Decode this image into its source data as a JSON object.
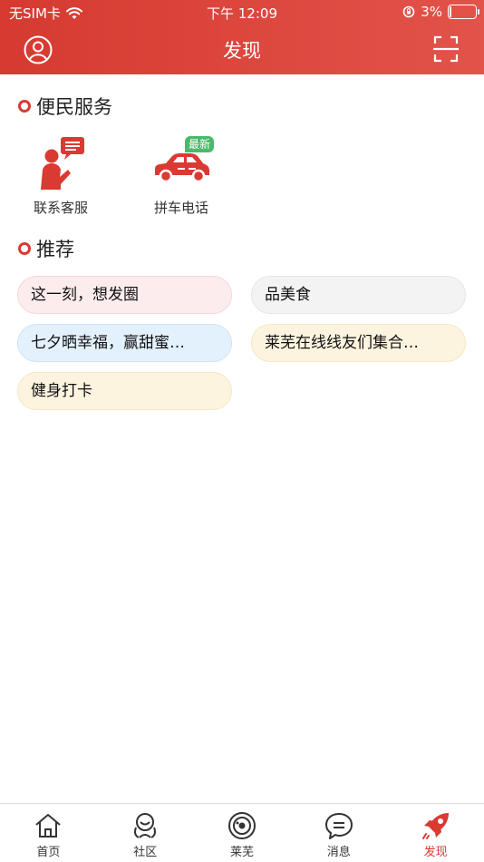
{
  "status_bar": {
    "carrier": "无SIM卡",
    "time": "下午 12:09",
    "battery": "3%",
    "battery_level": 0.03
  },
  "nav": {
    "title": "发现",
    "left_icon": "user-icon",
    "right_icon": "scan-icon"
  },
  "services": {
    "title": "便民服务",
    "items": [
      {
        "label": "联系客服",
        "icon": "customer-service-icon"
      },
      {
        "label": "拼车电话",
        "icon": "car-icon",
        "badge": "最新"
      }
    ]
  },
  "recommend": {
    "title": "推荐",
    "tags": [
      {
        "label": "这一刻，想发圈",
        "bg": "#fdeced",
        "border": "#f8d6d8"
      },
      {
        "label": "品美食",
        "bg": "#f3f3f3",
        "border": "#e6e6e6"
      },
      {
        "label": "七夕晒幸福，赢甜蜜…",
        "bg": "#e3f1fc",
        "border": "#cfe4f6"
      },
      {
        "label": "莱芜在线线友们集合…",
        "bg": "#fdf4df",
        "border": "#f5e8c6"
      },
      {
        "label": "健身打卡",
        "bg": "#fdf4df",
        "border": "#f5e8c6"
      }
    ]
  },
  "colors": {
    "accent": "#d93a32",
    "header_start": "#d63a30",
    "header_end": "#e2534a"
  },
  "tabbar": {
    "items": [
      {
        "label": "首页",
        "icon": "home-icon",
        "active": false
      },
      {
        "label": "社区",
        "icon": "community-icon",
        "active": false
      },
      {
        "label": "莱芜",
        "icon": "laiwu-icon",
        "active": false
      },
      {
        "label": "消息",
        "icon": "message-icon",
        "active": false
      },
      {
        "label": "发现",
        "icon": "discover-rocket-icon",
        "active": true
      }
    ]
  }
}
